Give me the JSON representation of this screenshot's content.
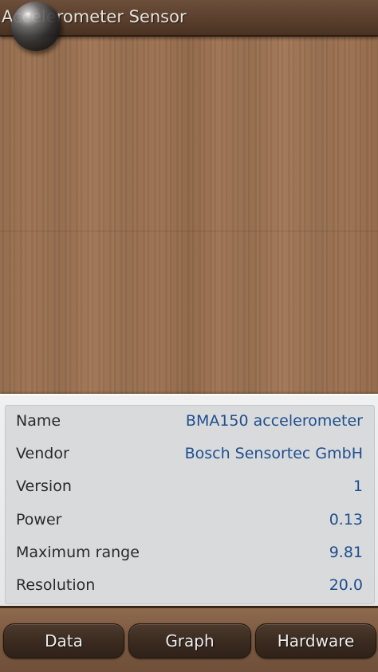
{
  "app": {
    "title": "Accelerometer Sensor"
  },
  "sensor_info": {
    "rows": [
      {
        "label": "Name",
        "value": "BMA150 accelerometer"
      },
      {
        "label": "Vendor",
        "value": "Bosch Sensortec GmbH"
      },
      {
        "label": "Version",
        "value": "1"
      },
      {
        "label": "Power",
        "value": "0.13"
      },
      {
        "label": "Maximum range",
        "value": "9.81"
      },
      {
        "label": "Resolution",
        "value": "20.0"
      }
    ]
  },
  "tabs": [
    {
      "label": "Data"
    },
    {
      "label": "Graph"
    },
    {
      "label": "Hardware"
    }
  ],
  "colors": {
    "value_text": "#1f4f8e",
    "label_text": "#2a2a2a",
    "wood_background": "#9a7050",
    "button_background": "#3b2b20"
  },
  "icons": {
    "ball": "metal-ball-icon"
  }
}
